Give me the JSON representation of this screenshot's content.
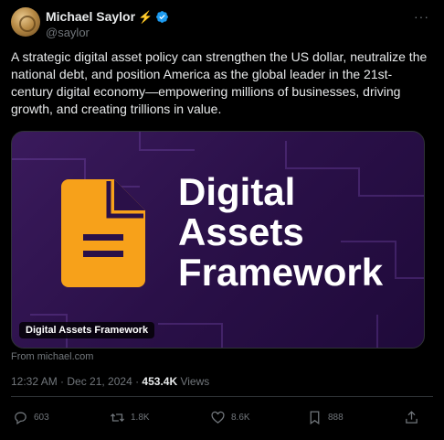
{
  "user": {
    "name": "Michael Saylor",
    "handle": "@saylor"
  },
  "more_icon": "more-horizontal-icon",
  "tweet_text": "A strategic digital asset policy can strengthen the US dollar, neutralize the national debt, and position America as the global leader in the 21st-century digital economy—empowering millions of businesses, driving growth, and creating trillions in value.",
  "card": {
    "title_line1": "Digital",
    "title_line2": "Assets",
    "title_line3": "Framework",
    "badge": "Digital Assets Framework",
    "source": "From michael.com"
  },
  "meta": {
    "timestamp": "12:32 AM · Dec 21, 2024 · ",
    "views_count": "453.4K",
    "views_label": " Views"
  },
  "actions": {
    "replies": "603",
    "reposts": "1.8K",
    "likes": "8.6K",
    "bookmarks": "888"
  },
  "colors": {
    "background": "#000000",
    "text": "#e7e9ea",
    "muted": "#71767b",
    "verified": "#1d9bf0",
    "doc_icon": "#f7a11a"
  }
}
